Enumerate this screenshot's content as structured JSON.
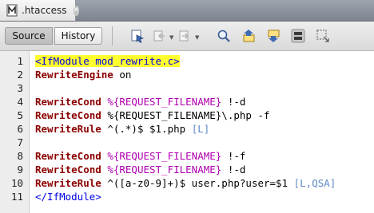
{
  "tab": {
    "filename": ".htaccess",
    "file_icon": "file-icon",
    "close_icon": "close-icon"
  },
  "toolbar": {
    "source_label": "Source",
    "history_label": "History",
    "icons": [
      "last-edit-icon",
      "back-icon",
      "forward-icon",
      "find-icon",
      "find-previous-icon",
      "find-next-icon",
      "toggle-highlight-icon",
      "toggle-rectangular-selection-icon"
    ]
  },
  "lines": [
    {
      "n": "1",
      "tokens": [
        {
          "t": "<IfModule mod_rewrite.c>",
          "k": "tag-hl"
        }
      ]
    },
    {
      "n": "2",
      "tokens": [
        {
          "t": "RewriteEngine",
          "k": "kw"
        },
        {
          "t": " on",
          "k": "txt"
        }
      ]
    },
    {
      "n": "3",
      "tokens": []
    },
    {
      "n": "4",
      "tokens": [
        {
          "t": "RewriteCond",
          "k": "kw"
        },
        {
          "t": " %{REQUEST_FILENAME}",
          "k": "var"
        },
        {
          "t": " !-d",
          "k": "txt"
        }
      ]
    },
    {
      "n": "5",
      "tokens": [
        {
          "t": "RewriteCond",
          "k": "kw"
        },
        {
          "t": " %{REQUEST_FILENAME}\\.php -f",
          "k": "txt"
        }
      ]
    },
    {
      "n": "6",
      "tokens": [
        {
          "t": "RewriteRule",
          "k": "kw"
        },
        {
          "t": " ^(.*)$ $1.php ",
          "k": "txt"
        },
        {
          "t": "[L]",
          "k": "flag"
        }
      ]
    },
    {
      "n": "7",
      "tokens": []
    },
    {
      "n": "8",
      "tokens": [
        {
          "t": "RewriteCond",
          "k": "kw"
        },
        {
          "t": " %{REQUEST_FILENAME}",
          "k": "var"
        },
        {
          "t": " !-f",
          "k": "txt"
        }
      ]
    },
    {
      "n": "9",
      "tokens": [
        {
          "t": "RewriteCond",
          "k": "kw"
        },
        {
          "t": " %{REQUEST_FILENAME}",
          "k": "var"
        },
        {
          "t": " !-d",
          "k": "txt"
        }
      ]
    },
    {
      "n": "10",
      "tokens": [
        {
          "t": "RewriteRule",
          "k": "kw"
        },
        {
          "t": " ^([a-z0-9]+)$ user.php?user=$1 ",
          "k": "txt"
        },
        {
          "t": "[L,QSA]",
          "k": "flag"
        }
      ]
    },
    {
      "n": "11",
      "tokens": [
        {
          "t": "</IfModule>",
          "k": "tag"
        }
      ]
    }
  ]
}
